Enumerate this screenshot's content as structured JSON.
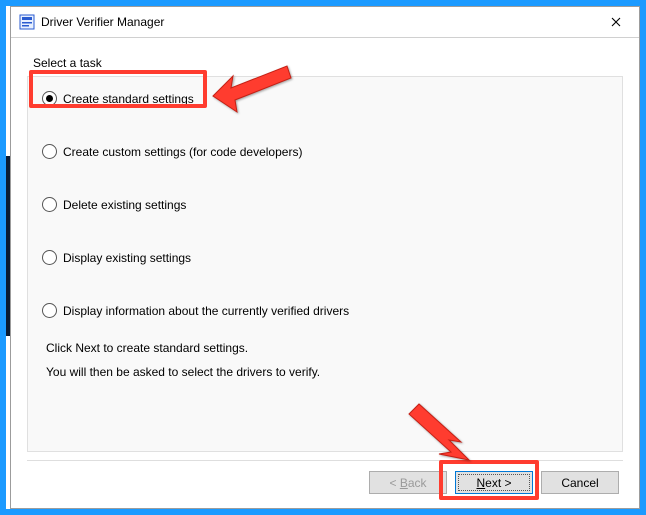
{
  "window": {
    "title": "Driver Verifier Manager"
  },
  "prompt": "Select a task",
  "options": [
    {
      "label": "Create standard settings",
      "selected": true
    },
    {
      "label": "Create custom settings (for code developers)",
      "selected": false
    },
    {
      "label": "Delete existing settings",
      "selected": false
    },
    {
      "label": "Display existing settings",
      "selected": false
    },
    {
      "label": "Display information about the currently verified drivers",
      "selected": false
    }
  ],
  "help": {
    "line1": "Click Next to create standard settings.",
    "line2": "You will then be asked to select the drivers to verify."
  },
  "buttons": {
    "back": "< Back",
    "next": "Next >",
    "cancel": "Cancel"
  },
  "annotations": {
    "highlight_option_index": 0,
    "highlight_button": "next",
    "color": "#ff3c2f"
  }
}
